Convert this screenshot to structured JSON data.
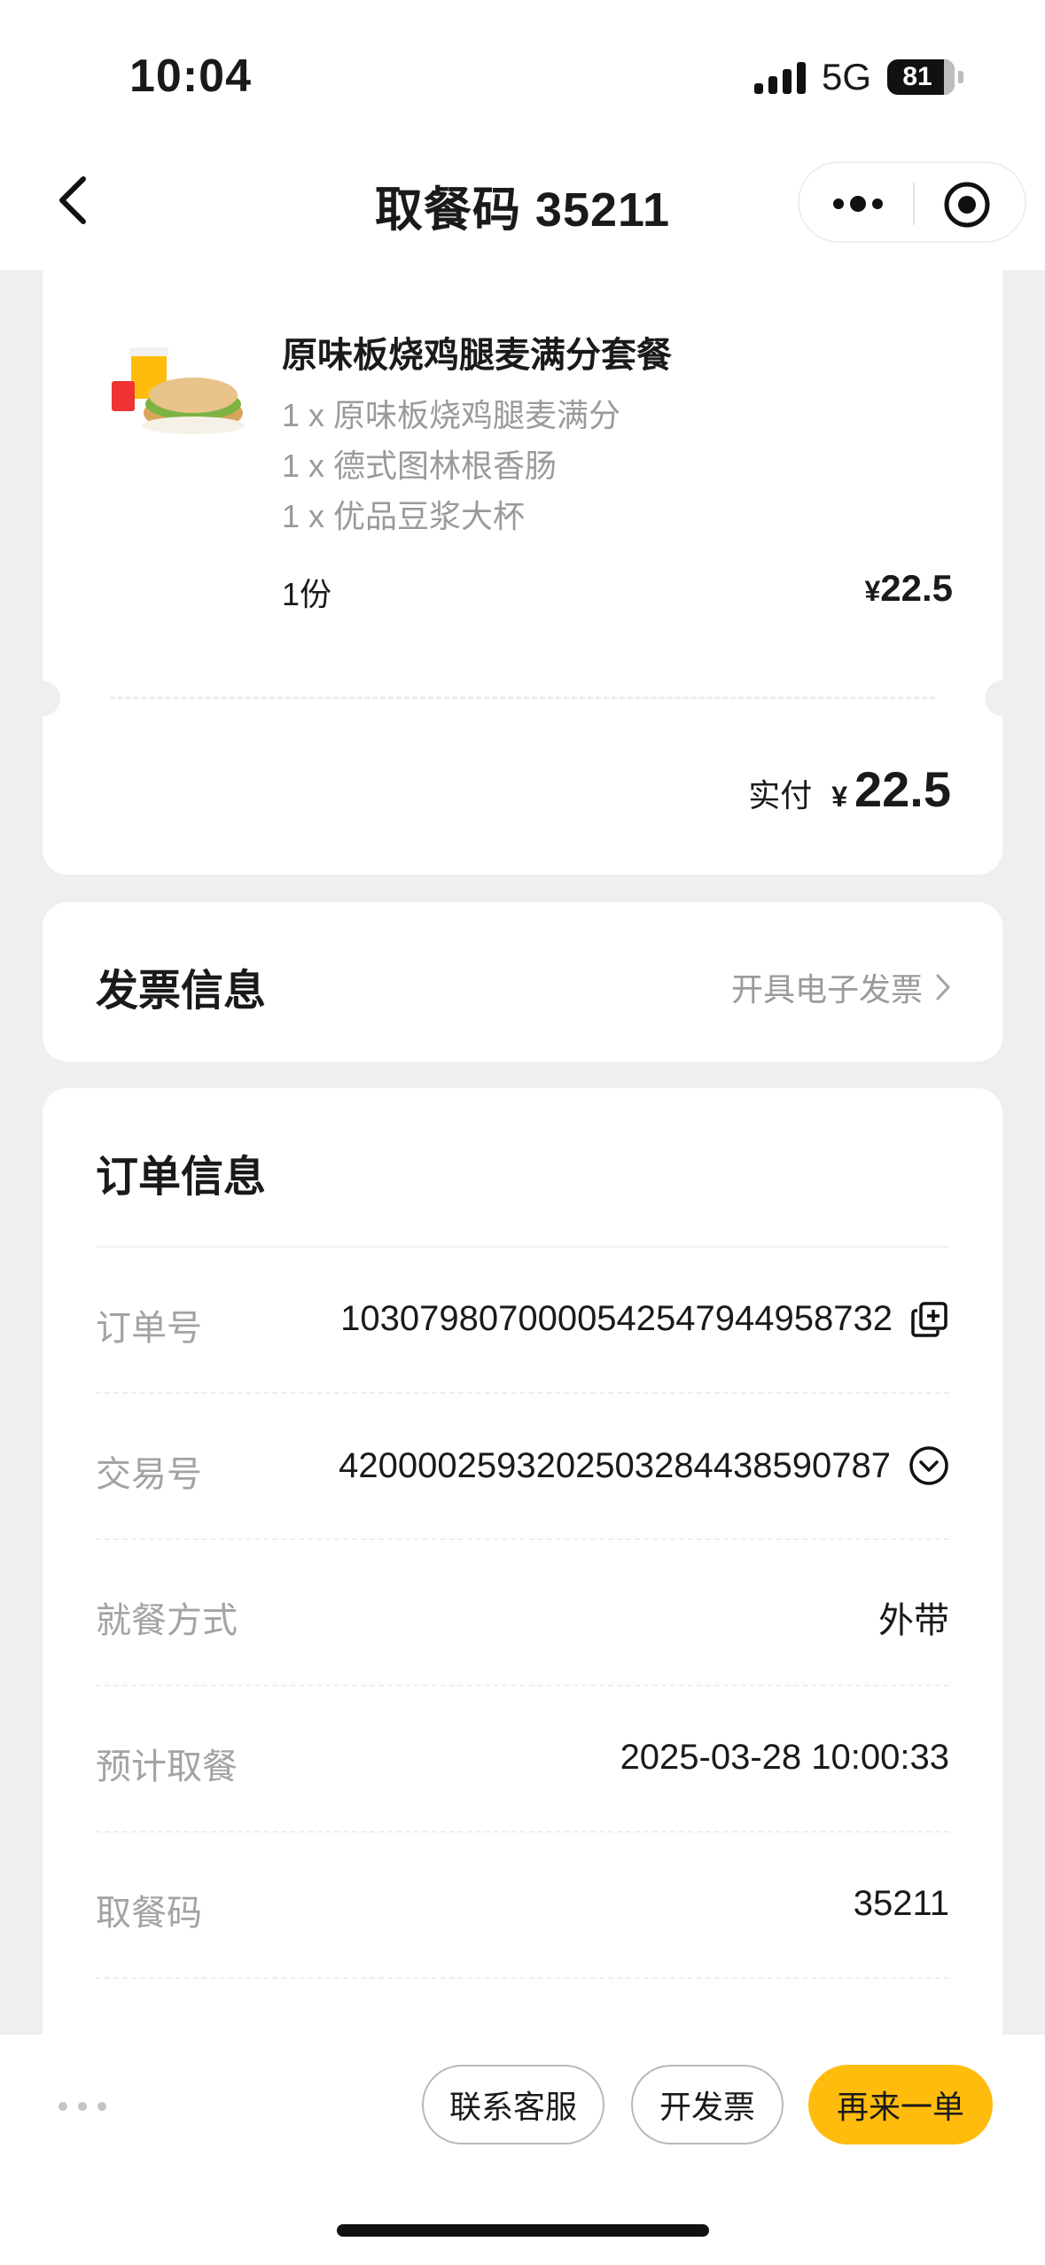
{
  "status_bar": {
    "time": "10:04",
    "network": "5G",
    "battery": "81"
  },
  "header": {
    "title": "取餐码 35211"
  },
  "order_item": {
    "name": "原味板烧鸡腿麦满分套餐",
    "components": [
      "1 x 原味板烧鸡腿麦满分",
      "1 x 德式图林根香肠",
      "1 x 优品豆浆大杯"
    ],
    "quantity": "1份",
    "currency": "¥",
    "price": "22.5",
    "paid_label": "实付",
    "paid_amount": "22.5"
  },
  "invoice": {
    "title": "发票信息",
    "action": "开具电子发票"
  },
  "order_info": {
    "title": "订单信息",
    "rows": [
      {
        "label": "订单号",
        "value": "1030798070000542547944958732",
        "icon": "copy-icon"
      },
      {
        "label": "交易号",
        "value": "4200002593202503284438590787",
        "icon": "chevron-down-circle-icon"
      },
      {
        "label": "就餐方式",
        "value": "外带"
      },
      {
        "label": "预计取餐",
        "value": "2025-03-28 10:00:33"
      },
      {
        "label": "取餐码",
        "value": "35211"
      }
    ]
  },
  "bottom_bar": {
    "contact_service": "联系客服",
    "issue_invoice": "开发票",
    "reorder": "再来一单"
  },
  "colors": {
    "accent": "#ffbc0d",
    "background": "#efefef",
    "muted_text": "#a3a3a3"
  }
}
